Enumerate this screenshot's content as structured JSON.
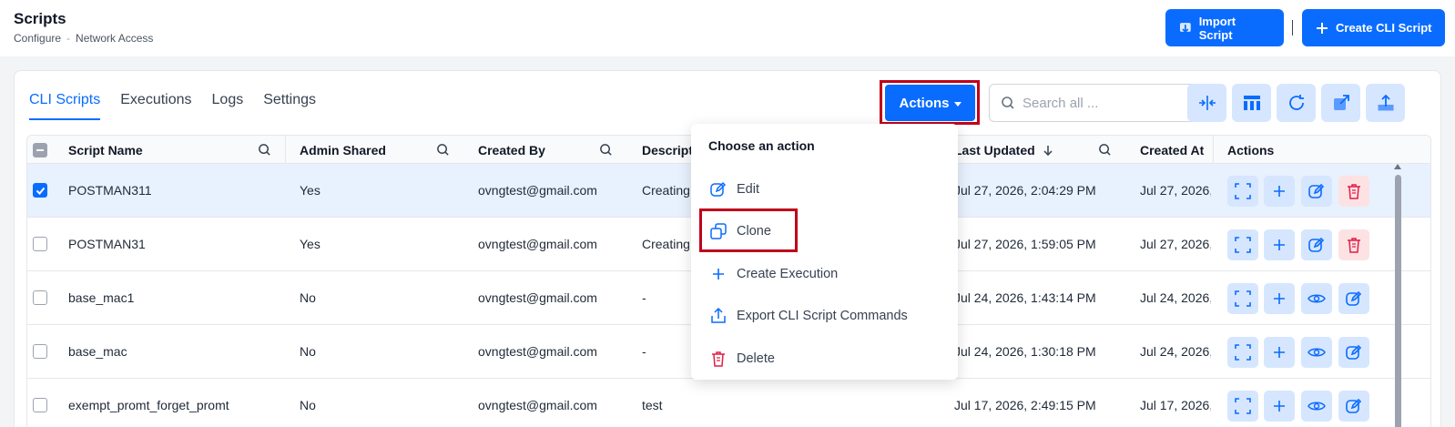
{
  "header": {
    "title": "Scripts",
    "breadcrumb": [
      "Configure",
      "-",
      "Network Access"
    ],
    "import_label": "Import Script",
    "create_label": "Create CLI Script"
  },
  "tabs": [
    {
      "label": "CLI Scripts",
      "active": true
    },
    {
      "label": "Executions",
      "active": false
    },
    {
      "label": "Logs",
      "active": false
    },
    {
      "label": "Settings",
      "active": false
    }
  ],
  "toolbar": {
    "actions_label": "Actions",
    "search_placeholder": "Search all ...",
    "tool_icons": [
      "compress-columns-icon",
      "columns-icon",
      "refresh-icon",
      "external-link-icon",
      "upload-icon"
    ]
  },
  "table": {
    "columns": [
      "Script Name",
      "Admin Shared",
      "Created By",
      "Descripti",
      "Last Updated",
      "Created At",
      "Actions"
    ],
    "rows": [
      {
        "checked": true,
        "name": "POSTMAN311",
        "shared": "Yes",
        "by": "ovngtest@gmail.com",
        "desc": "Creating",
        "updated": "Jul 27, 2026, 2:04:29 PM",
        "created": "Jul 27, 2026, 2",
        "actions": [
          "expand",
          "add",
          "edit",
          "delete"
        ]
      },
      {
        "checked": false,
        "name": "POSTMAN31",
        "shared": "Yes",
        "by": "ovngtest@gmail.com",
        "desc": "Creating",
        "updated": "Jul 27, 2026, 1:59:05 PM",
        "created": "Jul 27, 2026,",
        "actions": [
          "expand",
          "add",
          "edit",
          "delete"
        ]
      },
      {
        "checked": false,
        "name": "base_mac1",
        "shared": "No",
        "by": "ovngtest@gmail.com",
        "desc": "-",
        "updated": "Jul 24, 2026, 1:43:14 PM",
        "created": "Jul 24, 2026,",
        "actions": [
          "expand",
          "add",
          "view",
          "edit"
        ]
      },
      {
        "checked": false,
        "name": "base_mac",
        "shared": "No",
        "by": "ovngtest@gmail.com",
        "desc": "-",
        "updated": "Jul 24, 2026, 1:30:18 PM",
        "created": "Jul 24, 2026,",
        "actions": [
          "expand",
          "add",
          "view",
          "edit"
        ]
      },
      {
        "checked": false,
        "name": "exempt_promt_forget_promt",
        "shared": "No",
        "by": "ovngtest@gmail.com",
        "desc": "test",
        "updated": "Jul 17, 2026, 2:49:15 PM",
        "created": "Jul 17, 2026,",
        "actions": [
          "expand",
          "add",
          "view",
          "edit"
        ]
      }
    ]
  },
  "dropdown": {
    "title": "Choose an action",
    "items": [
      {
        "label": "Edit",
        "icon": "edit-icon"
      },
      {
        "label": "Clone",
        "icon": "clone-icon"
      },
      {
        "label": "Create Execution",
        "icon": "plus-icon"
      },
      {
        "label": "Export CLI Script Commands",
        "icon": "export-icon"
      },
      {
        "label": "Delete",
        "icon": "trash-icon"
      }
    ]
  },
  "colors": {
    "primary": "#0a6cff",
    "danger": "#e11d48",
    "highlight": "#c0001a",
    "selected_row": "#e8f1fe"
  }
}
